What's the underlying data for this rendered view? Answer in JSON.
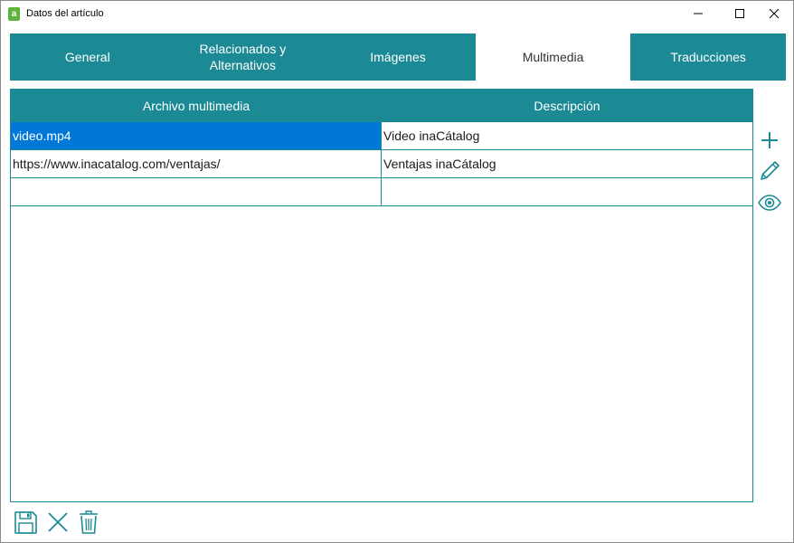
{
  "window": {
    "title": "Datos del artículo",
    "app_icon_glyph": "a"
  },
  "tabs": [
    {
      "label": "General",
      "active": false
    },
    {
      "label": "Relacionados y\nAlternativos",
      "active": false
    },
    {
      "label": "Imágenes",
      "active": false
    },
    {
      "label": "Multimedia",
      "active": true
    },
    {
      "label": "Traducciones",
      "active": false
    }
  ],
  "grid": {
    "columns": [
      "Archivo multimedia",
      "Descripción"
    ],
    "rows": [
      {
        "file": "video.mp4",
        "description": "Video inaCátalog",
        "selected": true
      },
      {
        "file": "https://www.inacatalog.com/ventajas/",
        "description": "Ventajas inaCátalog",
        "selected": false
      },
      {
        "file": "",
        "description": "",
        "selected": false
      }
    ]
  },
  "side_actions": [
    "plus-icon",
    "pencil-icon",
    "eye-icon"
  ],
  "bottom_actions": [
    "save-icon",
    "cancel-x-icon",
    "trash-icon"
  ],
  "colors": {
    "accent": "#1b8a94",
    "selection": "#0078d7",
    "app_icon": "#5db33e"
  }
}
